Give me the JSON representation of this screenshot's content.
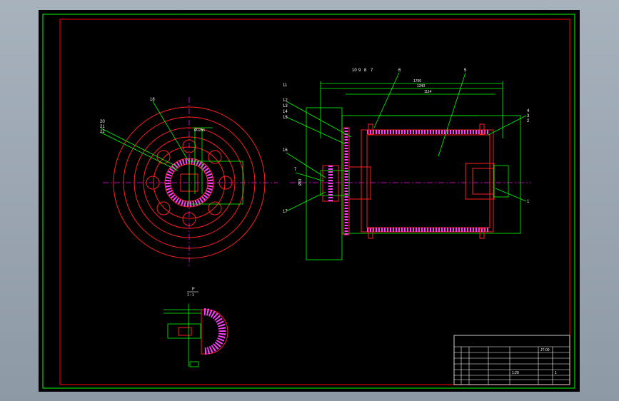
{
  "colors": {
    "background": "#000000",
    "frame_outer": "#00ff00",
    "frame_inner": "#ff0000",
    "outline": "#ff2020",
    "dimension": "#00ff00",
    "leader": "#00ff00",
    "centerline": "#ff00ff",
    "hatch": "#ff40ff",
    "text": "#ffffff",
    "label": "#ffffff"
  },
  "left_view": {
    "callouts": [
      "18",
      "20",
      "21",
      "22"
    ],
    "dim_top": "Ø12h6"
  },
  "right_view": {
    "callouts_top": [
      "10",
      "9",
      "8",
      "7",
      "6",
      "5"
    ],
    "callouts_left": [
      "11",
      "12",
      "13",
      "14",
      "15",
      "16",
      "7",
      "17"
    ],
    "callouts_right": [
      "4",
      "3",
      "2",
      "1"
    ],
    "dims": [
      "1700",
      "1340",
      "1114",
      "Ø63"
    ]
  },
  "section_view": {
    "title_top": "F",
    "title_bottom": "1 : 1"
  },
  "title_block": {
    "scale": "1:20",
    "sheet": "1",
    "drawing_no": "JT-00"
  }
}
